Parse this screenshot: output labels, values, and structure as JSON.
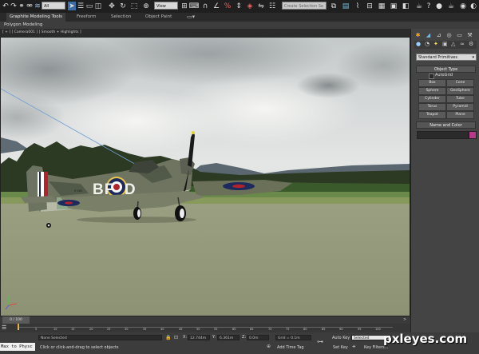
{
  "toolbar": {
    "selection_filter": "All",
    "ref_coord": "View",
    "named_selection": "Create Selection Se",
    "icons": [
      "undo-icon",
      "redo-icon",
      "link-icon",
      "unlink-icon",
      "bind-space-warp-icon",
      "select-object-icon",
      "select-by-name-icon",
      "rectangle-selection-icon",
      "window-crossing-icon",
      "select-and-move-icon",
      "select-and-rotate-icon",
      "select-and-scale-icon",
      "pivot-icon",
      "select-manipulate-icon",
      "keyboard-shortcut-icon",
      "snap-icon",
      "angle-snap-icon",
      "percent-snap-icon",
      "spinner-snap-icon",
      "edit-named-selection-icon",
      "mirror-icon",
      "align-icon",
      "layer-icon",
      "graphite-icon",
      "curve-editor-icon",
      "schematic-view-icon",
      "material-editor-icon",
      "render-setup-icon",
      "rendered-frame-icon",
      "render-icon"
    ]
  },
  "ribbon": {
    "tabs": [
      "Graphite Modeling Tools",
      "Freeform",
      "Selection",
      "Object Paint"
    ],
    "panel_label": "Polygon Modeling"
  },
  "viewport": {
    "label": "[ + ] [ Camera001 ] [ Smooth + Highlights ]",
    "aircraft_markings": "BF  D",
    "serial": "R·X83"
  },
  "command_panel": {
    "category": "Standard Primitives",
    "object_type_title": "Object Type",
    "autogrid_label": "AutoGrid",
    "primitives": [
      "Box",
      "Cone",
      "Sphere",
      "GeoSphere",
      "Cylinder",
      "Tube",
      "Torus",
      "Pyramid",
      "Teapot",
      "Plane"
    ],
    "name_color_title": "Name and Color",
    "color": "#b8388a"
  },
  "timeline": {
    "frame_display": "0 / 100",
    "ticks": [
      "0",
      "5",
      "10",
      "15",
      "20",
      "25",
      "30",
      "35",
      "40",
      "45",
      "50",
      "55",
      "60",
      "65",
      "70",
      "75",
      "80",
      "85",
      "90",
      "95",
      "100"
    ]
  },
  "status": {
    "maxscript": "Max to Physc",
    "selection": "None Selected",
    "prompt": "Click or click-and-drag to select objects",
    "x_label": "X:",
    "x_value": "12.744m",
    "y_label": "Y:",
    "y_value": "6.361m",
    "z_label": "Z:",
    "z_value": "0.0m",
    "grid": "Grid = 0.1m",
    "add_time_tag": "Add Time Tag",
    "auto_key": "Auto Key",
    "set_key": "Set Key",
    "key_mode": "Selected",
    "key_filters": "Key Filters..."
  },
  "watermark": "pxleyes.com"
}
